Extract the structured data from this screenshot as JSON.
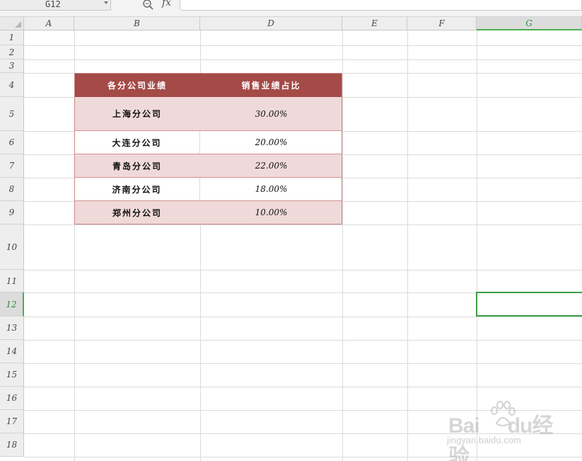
{
  "formula_bar": {
    "name_box": "G12",
    "fx_label": "fx",
    "formula_value": ""
  },
  "columns": [
    "A",
    "B",
    "D",
    "E",
    "F",
    "G"
  ],
  "active_column": "G",
  "rows": [
    "1",
    "2",
    "3",
    "4",
    "5",
    "6",
    "7",
    "8",
    "9",
    "10",
    "11",
    "12",
    "13",
    "14",
    "15",
    "16",
    "17",
    "18"
  ],
  "active_row": "12",
  "table": {
    "headers": [
      "各分公司业绩",
      "销售业绩占比"
    ],
    "rows": [
      {
        "name": "上海分公司",
        "share": "30.00%"
      },
      {
        "name": "大连分公司",
        "share": "20.00%"
      },
      {
        "name": "青岛分公司",
        "share": "22.00%"
      },
      {
        "name": "济南分公司",
        "share": "18.00%"
      },
      {
        "name": "郑州分公司",
        "share": "10.00%"
      }
    ]
  },
  "colors": {
    "header_fill": "#a44a47",
    "band_fill": "#efdad9",
    "selection": "#3d9c47"
  },
  "watermark": {
    "brand_left": "Bai",
    "brand_mid": "du",
    "brand_right": "经验",
    "url": "jingyan.baidu.com"
  }
}
